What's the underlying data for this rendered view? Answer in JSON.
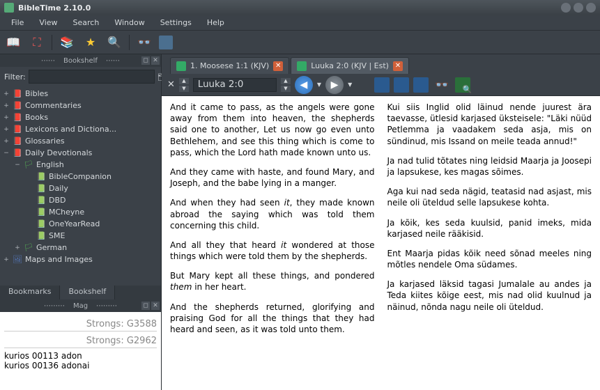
{
  "app": {
    "title": "BibleTime 2.10.0"
  },
  "menu": {
    "file": "File",
    "view": "View",
    "search": "Search",
    "window": "Window",
    "settings": "Settings",
    "help": "Help"
  },
  "sidebar": {
    "panel_title": "Bookshelf",
    "filter_label": "Filter:",
    "filter_value": "",
    "items": {
      "bibles": "Bibles",
      "commentaries": "Commentaries",
      "books": "Books",
      "lexicons": "Lexicons and Dictiona...",
      "glossaries": "Glossaries",
      "devotionals": "Daily Devotionals",
      "english": "English",
      "dev_biblecompanion": "BibleCompanion",
      "dev_daily": "Daily",
      "dev_dbd": "DBD",
      "dev_mcheyne": "MCheyne",
      "dev_oneyearread": "OneYearRead",
      "dev_sme": "SME",
      "german": "German",
      "maps": "Maps and Images"
    },
    "tabs": {
      "bookmarks": "Bookmarks",
      "bookshelf": "Bookshelf"
    }
  },
  "mag": {
    "title": "Mag",
    "strong1": "Strongs: G3588",
    "strong2": "Strongs: G2962",
    "line1": "kurios 00113 adon",
    "line2": "kurios 00136 adonai"
  },
  "doc_tabs": {
    "tab1": "1. Moosese 1:1 (KJV)",
    "tab2": "Luuka 2:0 (KJV | Est)"
  },
  "location": "Luuka 2:0",
  "verses_left": {
    "p1a": "And it came to pass, as the angels were gone away from them into heaven, the shepherds said one to another, Let us now go even unto Bethlehem, and see this thing which is come to pass, which the Lord hath made known unto us.",
    "p2": "And they came with haste, and found Mary, and Joseph, and the babe lying in a manger.",
    "p3a": "And when they had seen ",
    "p3it": "it",
    "p3b": ", they made known abroad the saying which was told them concerning this child.",
    "p4a": "And all they that heard ",
    "p4it": "it",
    "p4b": " wondered at those things which were told them by the shepherds.",
    "p5a": "But Mary kept all these things, and pondered ",
    "p5it": "them",
    "p5b": " in her heart.",
    "p6": "And the shepherds returned, glorifying and praising God for all the things that they had heard and seen, as it was told unto them."
  },
  "verses_right": {
    "p1": "Kui siis Inglid olid läinud nende juurest ära taevasse, ütlesid karjased üksteisele: \"Läki nüüd Petlemma ja vaadakem seda asja, mis on sündinud, mis Issand on meile teada annud!\"",
    "p2": "Ja nad tulid tõtates ning leidsid Maarja ja Joosepi ja lapsukese, kes magas sõimes.",
    "p3": "Aga kui nad seda nägid, teatasid nad asjast, mis neile oli üteldud selle lapsukese kohta.",
    "p4": "Ja kõik, kes seda kuulsid, panid imeks, mida karjased neile rääkisid.",
    "p5": "Ent Maarja pidas kõik need sõnad meeles ning mõtles nendele Oma südames.",
    "p6": "Ja karjased läksid tagasi Jumalale au andes ja Teda kiites kõige eest, mis nad olid kuulnud ja näinud, nõnda nagu neile oli üteldud."
  }
}
